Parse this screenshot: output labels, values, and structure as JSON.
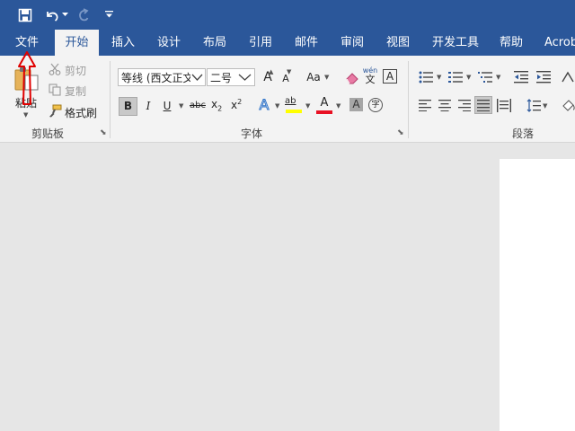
{
  "quick_access": {
    "save_icon": "save-icon",
    "undo_icon": "undo-icon",
    "redo_icon": "redo-icon",
    "customize_icon": "customize-qat-icon"
  },
  "tabs": [
    {
      "label": "文件"
    },
    {
      "label": "开始"
    },
    {
      "label": "插入"
    },
    {
      "label": "设计"
    },
    {
      "label": "布局"
    },
    {
      "label": "引用"
    },
    {
      "label": "邮件"
    },
    {
      "label": "审阅"
    },
    {
      "label": "视图"
    },
    {
      "label": "开发工具"
    },
    {
      "label": "帮助"
    },
    {
      "label": "Acrob"
    }
  ],
  "clipboard": {
    "paste_label": "粘贴",
    "cut_label": "剪切",
    "copy_label": "复制",
    "format_painter_label": "格式刷",
    "group_label": "剪贴板"
  },
  "font": {
    "font_name": "等线 (西文正文",
    "font_size": "二号",
    "grow_label": "A",
    "shrink_label": "A",
    "case_label": "Aa",
    "pinyin_top": "wén",
    "pinyin_bottom": "文",
    "border_char_label": "A",
    "bold_label": "B",
    "italic_label": "I",
    "underline_label": "U",
    "strike_label": "abc",
    "subscript_label": "x",
    "subscript_mark": "2",
    "superscript_label": "x",
    "superscript_mark": "2",
    "text_effect_label": "A",
    "highlight_label": "ab",
    "font_color_label": "A",
    "shading_label": "A",
    "enclose_label": "字",
    "group_label": "字体"
  },
  "paragraph": {
    "group_label": "段落"
  },
  "colors": {
    "ribbon_blue": "#2b579a",
    "highlight_yellow": "#ffff00",
    "font_color_red": "#e81123",
    "annotation_red": "#e00000"
  }
}
